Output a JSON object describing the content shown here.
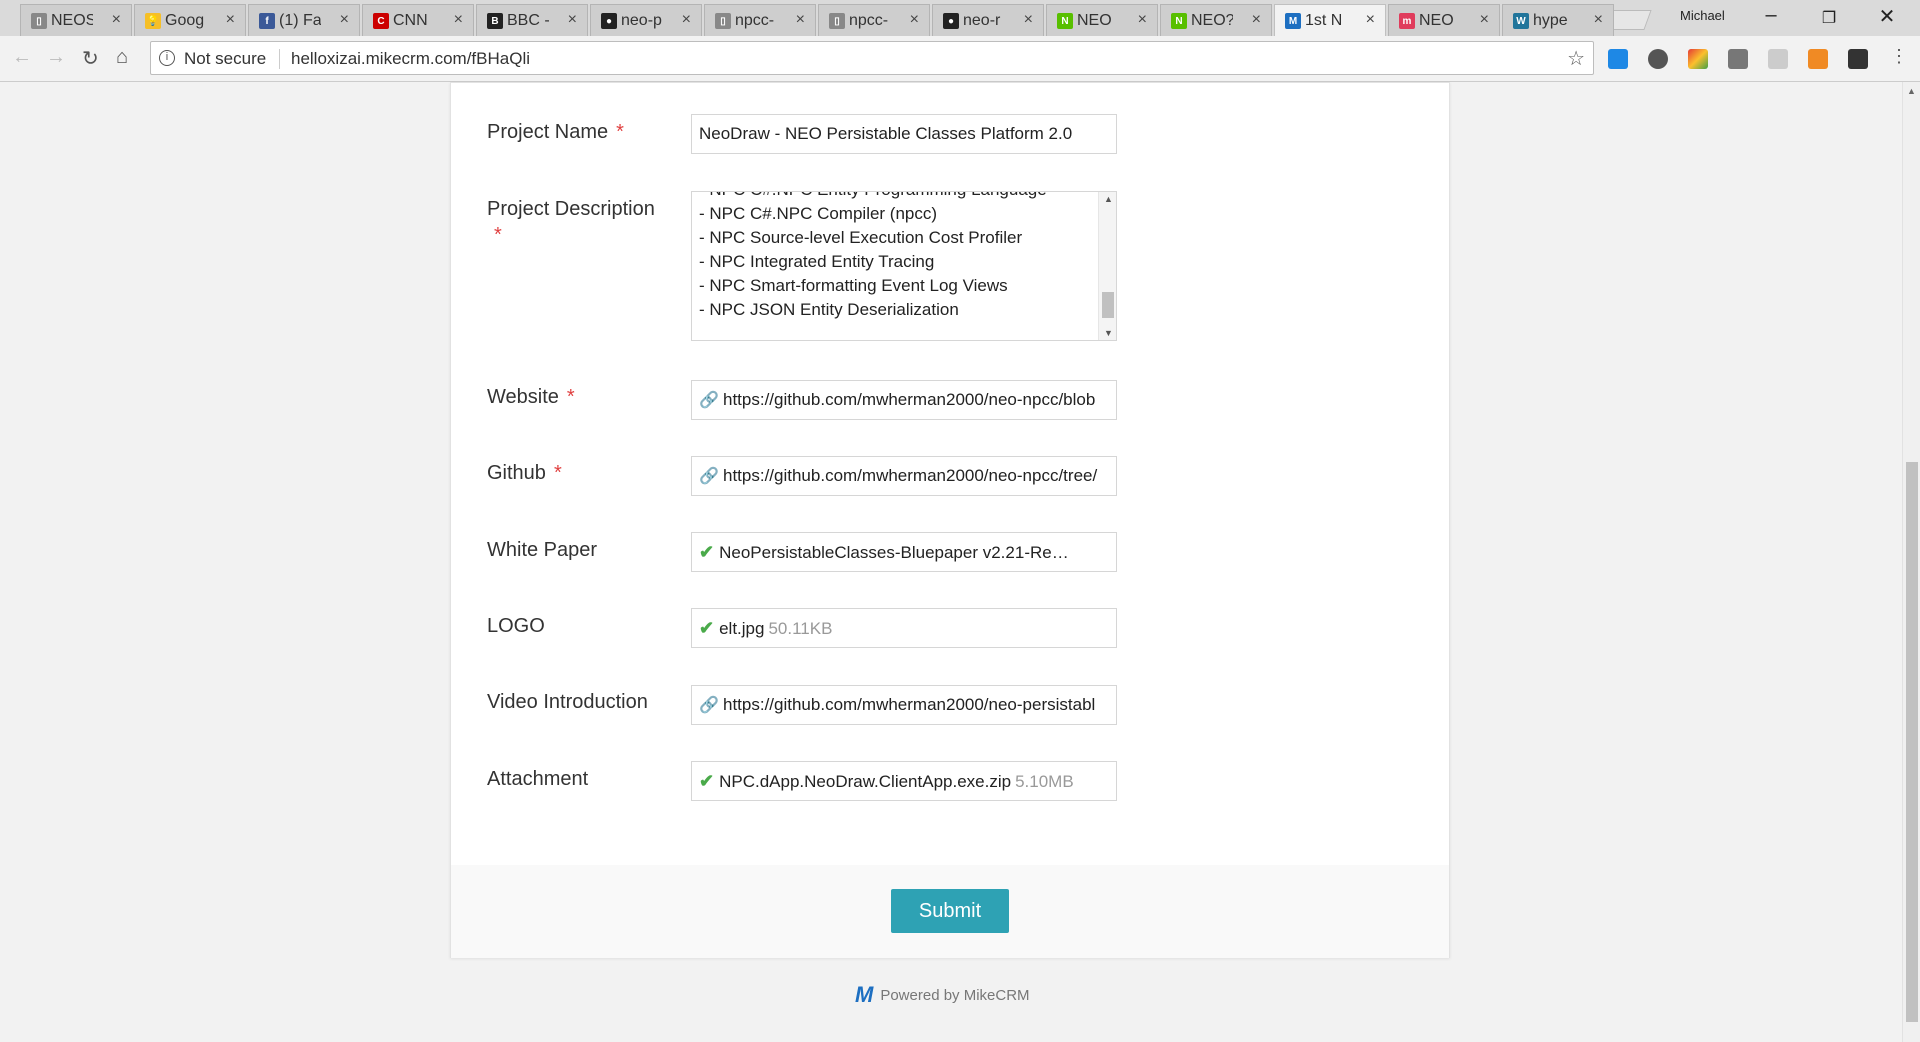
{
  "browser": {
    "tabs": [
      {
        "title": "NEOS",
        "icon": "page-icon",
        "color": "#888888"
      },
      {
        "title": "Goog",
        "icon": "google-keep-icon",
        "color": "#f6bf26"
      },
      {
        "title": "(1) Fa",
        "icon": "facebook-icon",
        "color": "#3b5998"
      },
      {
        "title": "CNN",
        "icon": "cnn-icon",
        "color": "#cc0000"
      },
      {
        "title": "BBC -",
        "icon": "bbc-icon",
        "color": "#222222"
      },
      {
        "title": "neo-p",
        "icon": "github-icon",
        "color": "#222222"
      },
      {
        "title": "npcc-",
        "icon": "page-icon",
        "color": "#888888"
      },
      {
        "title": "npcc-",
        "icon": "page-icon",
        "color": "#888888"
      },
      {
        "title": "neo-r",
        "icon": "github-icon",
        "color": "#222222"
      },
      {
        "title": "NEO",
        "icon": "neo-icon",
        "color": "#58bf00"
      },
      {
        "title": "NEO?",
        "icon": "neo-icon",
        "color": "#58bf00"
      },
      {
        "title": "1st N",
        "icon": "mikecrm-icon",
        "color": "#1d6fc1"
      },
      {
        "title": "NEO",
        "icon": "medium-icon",
        "color": "#e03c5c"
      },
      {
        "title": "hype",
        "icon": "wordpress-icon",
        "color": "#21759b"
      }
    ],
    "active_tab_index": 11,
    "profile_name": "Michael",
    "security_label": "Not secure",
    "url": "helloxizai.mikecrm.com/fBHaQli"
  },
  "form": {
    "project_name": {
      "label": "Project Name",
      "required": "*",
      "value": "NeoDraw - NEO Persistable Classes Platform 2.0"
    },
    "project_description": {
      "label": "Project Description",
      "required": "*",
      "lines": [
        "- NPC C#.NPC Entity Programming Language",
        "- NPC C#.NPC Compiler (npcc)",
        "- NPC Source-level Execution Cost Profiler",
        "- NPC Integrated Entity Tracing",
        "- NPC Smart-formatting Event Log Views",
        "- NPC JSON Entity Deserialization"
      ]
    },
    "website": {
      "label": "Website",
      "required": "*",
      "value": "https://github.com/mwherman2000/neo-npcc/blob"
    },
    "github": {
      "label": "Github",
      "required": "*",
      "value": "https://github.com/mwherman2000/neo-npcc/tree/"
    },
    "white_paper": {
      "label": "White Paper",
      "value": "NeoPersistableClasses-Bluepaper v2.21-Re…"
    },
    "logo": {
      "label": "LOGO",
      "value": "elt.jpg",
      "size": "50.11KB"
    },
    "video_introduction": {
      "label": "Video Introduction",
      "value": "https://github.com/mwherman2000/neo-persistabl"
    },
    "attachment": {
      "label": "Attachment",
      "value": "NPC.dApp.NeoDraw.ClientApp.exe.zip",
      "size": "5.10MB"
    },
    "submit_label": "Submit"
  },
  "footer": {
    "powered_by": "Powered by MikeCRM"
  }
}
